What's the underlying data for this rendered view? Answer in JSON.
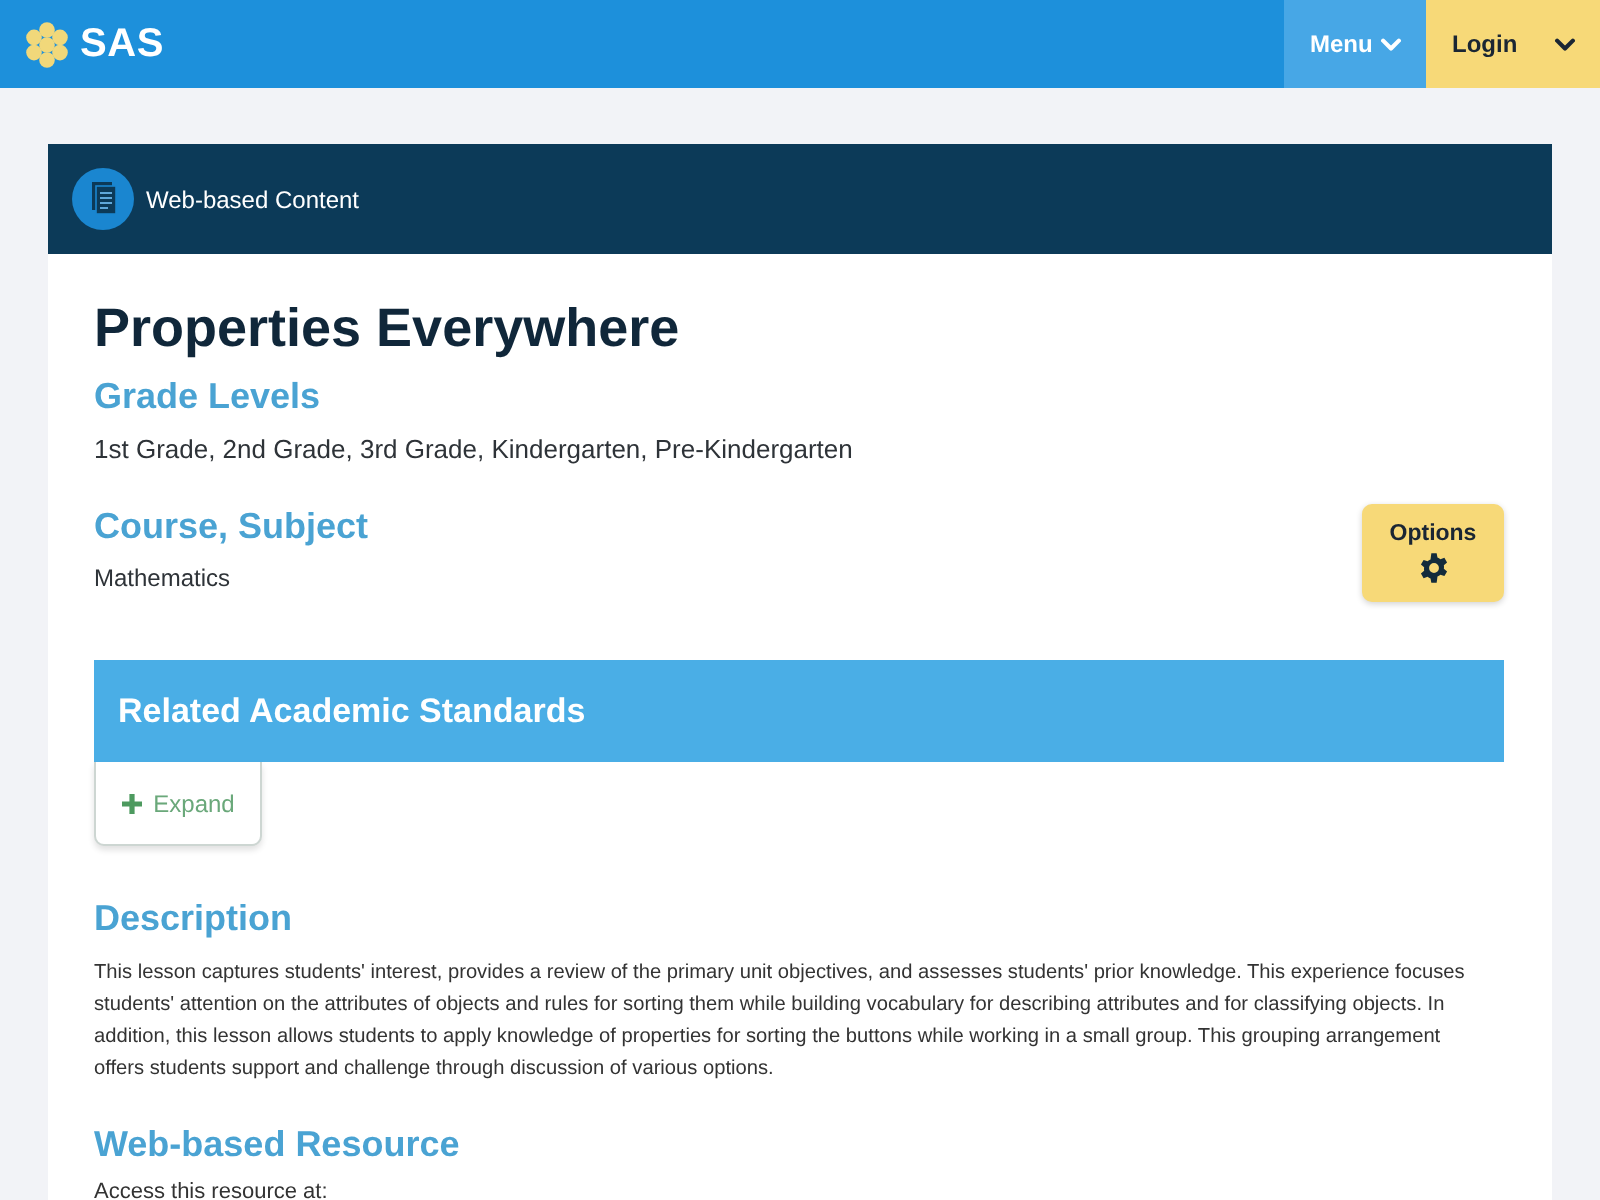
{
  "header": {
    "logo_text": "SAS",
    "buttons": [
      {
        "label": "Menu",
        "kind": "menu"
      },
      {
        "label": "Login",
        "kind": "login"
      }
    ]
  },
  "content_type": {
    "label": "Web-based Content"
  },
  "resource": {
    "title": "Properties Everywhere",
    "grade_levels": {
      "heading": "Grade Levels",
      "value": "1st Grade, 2nd Grade, 3rd Grade, Kindergarten, Pre-Kindergarten"
    },
    "course_subject": {
      "heading": "Course, Subject",
      "value": "Mathematics"
    },
    "options_button": {
      "label": "Options"
    },
    "standards": {
      "heading": "Related Academic Standards",
      "expand_label": "Expand"
    },
    "description": {
      "heading": "Description",
      "text": "This lesson captures students' interest, provides a review of the primary unit objectives, and assesses students' prior knowledge. This experience focuses students' attention on the attributes of objects and rules for sorting them while building vocabulary for describing attributes and for classifying objects. In addition, this lesson allows students to apply knowledge of properties for sorting the buttons while working in a small group. This grouping arrangement offers students support and challenge through discussion of various options."
    },
    "web_resource": {
      "heading": "Web-based Resource",
      "text": "Access this resource at:"
    }
  }
}
